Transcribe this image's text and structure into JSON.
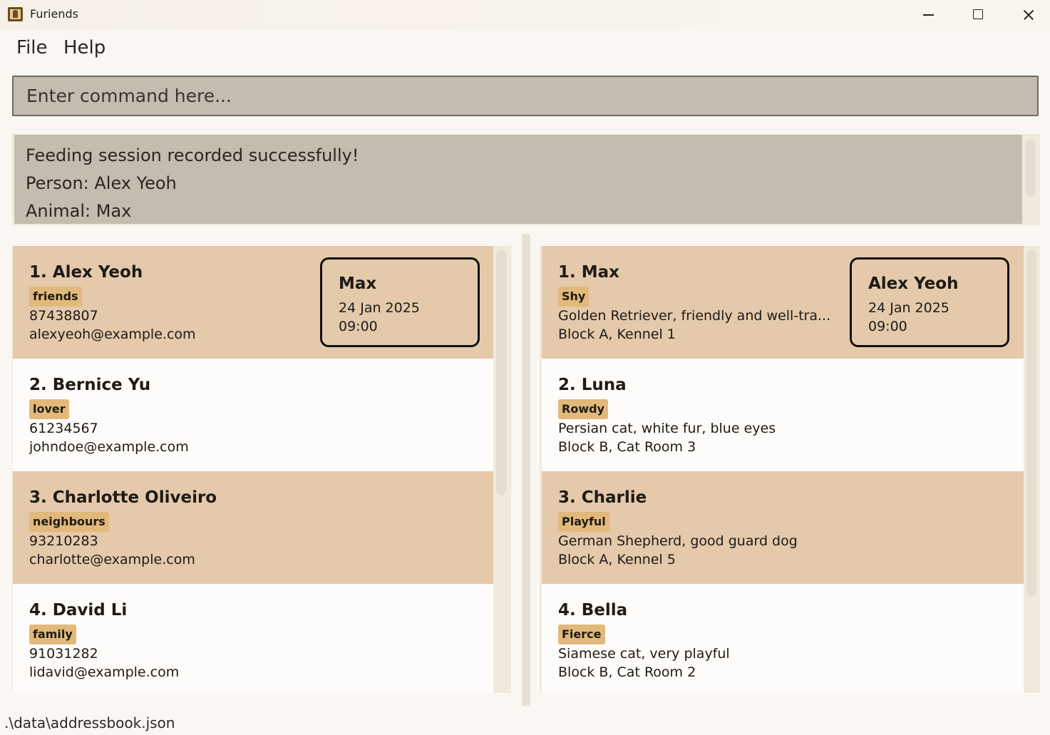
{
  "window": {
    "title": "Furiends",
    "icon": "app-logo-icon"
  },
  "menu": {
    "file": "File",
    "help": "Help"
  },
  "command": {
    "placeholder": "Enter command here...",
    "value": ""
  },
  "result": {
    "lines": [
      "Feeding session recorded successfully!",
      "Person: Alex Yeoh",
      "Animal: Max"
    ]
  },
  "persons": [
    {
      "index": "1.",
      "name": "Alex Yeoh",
      "tag": "friends",
      "phone": "87438807",
      "email": "alexyeoh@example.com",
      "feeding": {
        "name": "Max",
        "date": "24 Jan 2025",
        "time": "09:00"
      }
    },
    {
      "index": "2.",
      "name": "Bernice Yu",
      "tag": "lover",
      "phone": "61234567",
      "email": "johndoe@example.com"
    },
    {
      "index": "3.",
      "name": "Charlotte Oliveiro",
      "tag": "neighbours",
      "phone": "93210283",
      "email": "charlotte@example.com"
    },
    {
      "index": "4.",
      "name": "David Li",
      "tag": "family",
      "phone": "91031282",
      "email": "lidavid@example.com"
    }
  ],
  "animals": [
    {
      "index": "1.",
      "name": "Max",
      "tag": "Shy",
      "description": "Golden Retriever, friendly and well-tra...",
      "location": "Block A, Kennel 1",
      "feeding": {
        "name": "Alex Yeoh",
        "date": "24 Jan 2025",
        "time": "09:00"
      }
    },
    {
      "index": "2.",
      "name": "Luna",
      "tag": "Rowdy",
      "description": "Persian cat, white fur, blue eyes",
      "location": "Block B, Cat Room 3"
    },
    {
      "index": "3.",
      "name": "Charlie",
      "tag": "Playful",
      "description": "German Shepherd, good guard dog",
      "location": "Block A, Kennel 5"
    },
    {
      "index": "4.",
      "name": "Bella",
      "tag": "Fierce",
      "description": "Siamese cat, very playful",
      "location": "Block B, Cat Room 2"
    }
  ],
  "status": {
    "file_path": ".\\data\\addressbook.json"
  },
  "colors": {
    "card_odd": "#e4c9ab",
    "card_even": "#fefcfa",
    "tag_bg": "#e2b97a",
    "command_bg": "#c4bcae",
    "app_bg": "#faf7f3"
  }
}
